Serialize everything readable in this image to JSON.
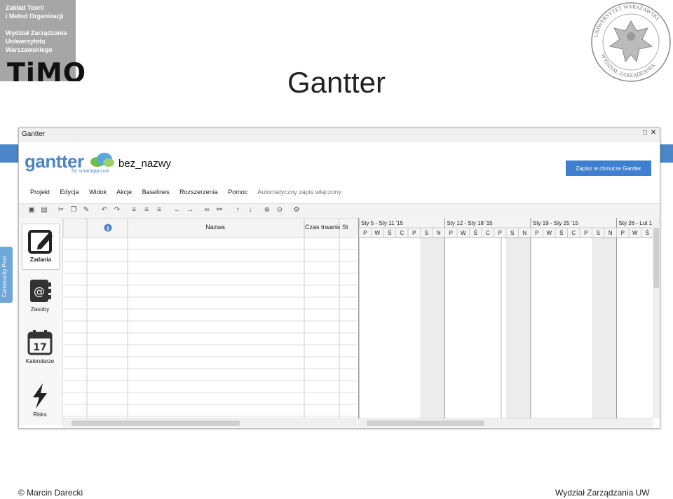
{
  "header": {
    "org_lines": [
      "Zakład Teorii",
      "i Metod Organizacji",
      "Wydział Zarządzania",
      "Uniwersytetu",
      "Warszawskiego"
    ],
    "logo_text": "TiMO",
    "slide_title": "Gantter",
    "seal_lines": [
      "UNIWERSYTET WARSZAWSKI",
      "WYDZIAŁ ZARZĄDZANIA"
    ]
  },
  "window": {
    "title": "Gantter",
    "brand": "gantter",
    "brand_sub": "for smartapp.com",
    "project_name": "bez_nazwy",
    "save_button": "Zapisz w chmurze Gantter",
    "menu": [
      "Projekt",
      "Edycja",
      "Widok",
      "Akcje",
      "Baselines",
      "Rozszerzenia",
      "Pomoc"
    ],
    "autosave": "Automatyczny zapis włączony",
    "sidebar": [
      {
        "label": "Zadania",
        "icon": "edit-icon"
      },
      {
        "label": "Zasoby",
        "icon": "address-book-icon"
      },
      {
        "label": "Kalendarze",
        "icon": "calendar-icon",
        "day": "17"
      },
      {
        "label": "Risks",
        "icon": "lightning-icon"
      }
    ],
    "grid_headers": {
      "info": "i",
      "name": "Nazwa",
      "duration": "Czas trwania",
      "start": "St"
    },
    "gantt_weeks": [
      "Sty 5 - Sty 11 '15",
      "Sty 12 - Sty 18 '15",
      "Sty 19 - Sty 25 '15",
      "Sty 26 - Lut 1"
    ],
    "day_letters": [
      "P",
      "W",
      "Ś",
      "C",
      "P",
      "S",
      "N"
    ],
    "community_tab": "Community Post"
  },
  "footer": {
    "left": "© Marcin Darecki",
    "right": "Wydział Zarządzania UW"
  }
}
